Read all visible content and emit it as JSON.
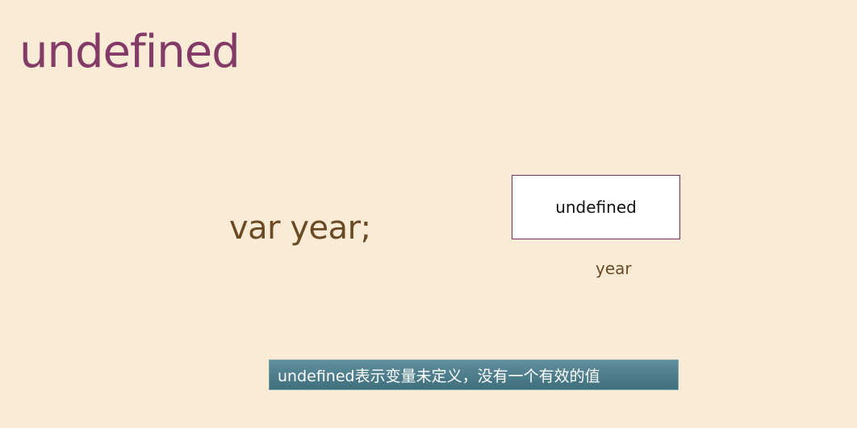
{
  "slide": {
    "title": "undefined"
  },
  "code": {
    "statement": "var year;"
  },
  "variable": {
    "value": "undefined",
    "name": "year"
  },
  "caption": {
    "text": "undefined表示变量未定义，没有一个有效的值"
  },
  "colors": {
    "background": "#faebd6",
    "title": "#833a67",
    "code": "#6a4a22",
    "box_border": "#7a2e5e",
    "caption_bg": "#4f7f8c"
  }
}
